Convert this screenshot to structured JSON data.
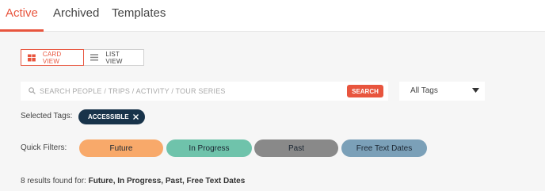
{
  "tabs": [
    {
      "label": "Active",
      "active": true
    },
    {
      "label": "Archived",
      "active": false
    },
    {
      "label": "Templates",
      "active": false
    }
  ],
  "view_toggle": {
    "card_label": "CARD VIEW",
    "list_label": "LIST VIEW",
    "selected": "card"
  },
  "search": {
    "placeholder": "SEARCH PEOPLE / TRIPS / ACTIVITY / TOUR SERIES",
    "button_label": "SEARCH"
  },
  "tag_filter": {
    "selected": "All Tags"
  },
  "selected_tags": {
    "label": "Selected Tags:",
    "tags": [
      {
        "label": "ACCESSIBLE"
      }
    ]
  },
  "quick_filters": {
    "label": "Quick Filters:",
    "items": [
      {
        "label": "Future",
        "color": "#f8a96a"
      },
      {
        "label": "In Progress",
        "color": "#6fc3ab"
      },
      {
        "label": "Past",
        "color": "#898989"
      },
      {
        "label": "Free Text Dates",
        "color": "#7ba0b8"
      }
    ]
  },
  "results": {
    "prefix": "8 results found for:",
    "filters": "Future, In Progress, Past, Free Text Dates"
  },
  "colors": {
    "accent": "#e8553e",
    "chip": "#18334a"
  }
}
